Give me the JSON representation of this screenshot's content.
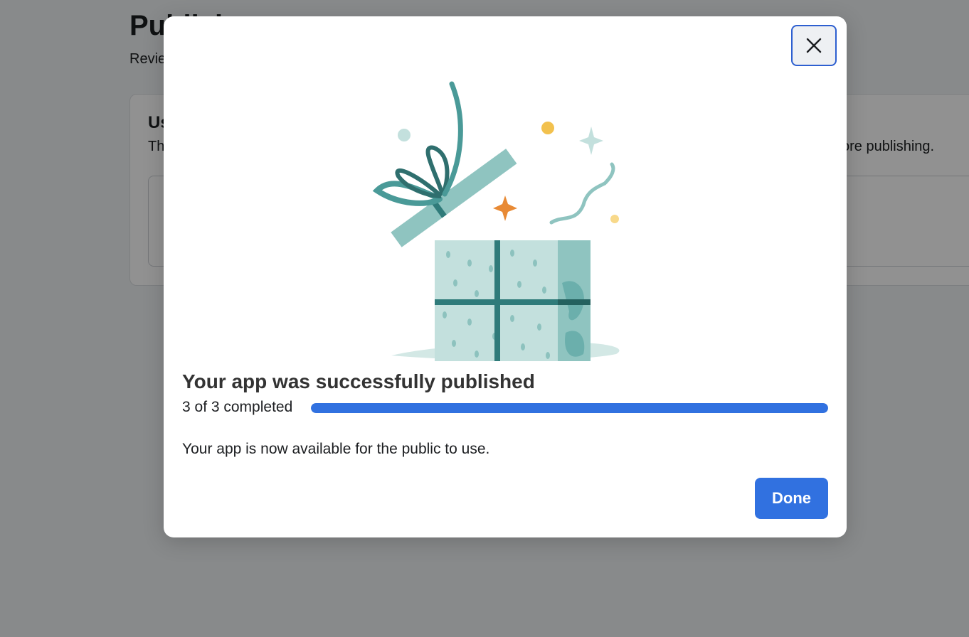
{
  "background": {
    "page_title": "Publish",
    "page_subtitle": "Review",
    "card_title": "Us",
    "card_text_left": "Th",
    "card_text_right": "ore publishing."
  },
  "modal": {
    "title": "Your app was successfully published",
    "progress_label": "3 of 3 completed",
    "progress": 1.0,
    "body_text": "Your app is now available for the public to use.",
    "done_label": "Done",
    "close_icon": "close-icon",
    "illustration_icon": "gift-box-icon"
  },
  "colors": {
    "primary": "#3171e0",
    "close_border": "#2d5fd0",
    "gift_teal": "#4a9a98",
    "gift_light": "#c3e0dd",
    "sparkle_orange": "#e88a35",
    "dot_yellow": "#f2c14e"
  }
}
